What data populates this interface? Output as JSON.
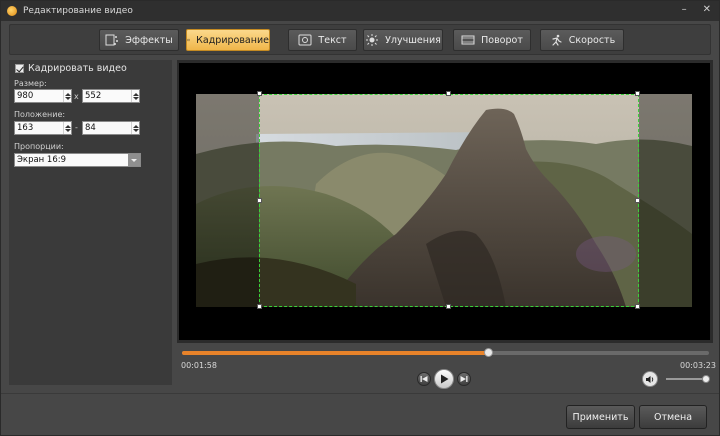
{
  "window": {
    "title": "Редактирование видео",
    "controls": [
      "–",
      "✕"
    ]
  },
  "tabs": [
    {
      "label": "Эффекты",
      "icon": "effects-icon",
      "active": false
    },
    {
      "label": "Кадрирование",
      "icon": "crop-icon",
      "active": true
    },
    {
      "label": "Текст",
      "icon": "text-icon",
      "active": false
    },
    {
      "label": "Улучшения",
      "icon": "brightness-icon",
      "active": false
    },
    {
      "label": "Поворот",
      "icon": "rotate-icon",
      "active": false
    },
    {
      "label": "Скорость",
      "icon": "speed-icon",
      "active": false
    }
  ],
  "crop_panel": {
    "enable_label": "Кадрировать видео",
    "enabled": true,
    "size_label": "Размер:",
    "width": "980",
    "height": "552",
    "size_separator": "x",
    "position_label": "Положение:",
    "pos_x": "163",
    "pos_y": "84",
    "position_separator": "-",
    "ratio_label": "Пропорции:",
    "ratio_value": "Экран 16:9"
  },
  "player": {
    "current_time": "00:01:58",
    "total_time": "00:03:23",
    "progress_fraction": 0.58,
    "volume_fraction": 0.95
  },
  "buttons": {
    "apply": "Применить",
    "cancel": "Отмена"
  },
  "colors": {
    "accent": "#f0b64a",
    "progress": "#e8832a",
    "crop_border": "#3ad13a"
  }
}
